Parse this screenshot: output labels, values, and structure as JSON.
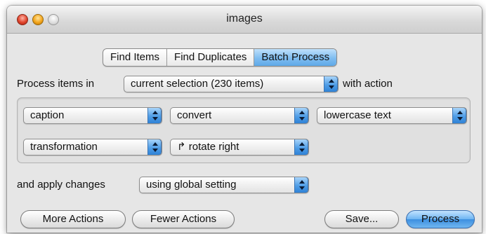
{
  "window": {
    "title": "images"
  },
  "tabs": [
    {
      "label": "Find Items",
      "active": false
    },
    {
      "label": "Find Duplicates",
      "active": false
    },
    {
      "label": "Batch Process",
      "active": true
    }
  ],
  "process_row": {
    "prefix": "Process items in",
    "scope_value": "current selection (230 items)",
    "suffix": "with action"
  },
  "actions": {
    "row1": {
      "target": "caption",
      "operation": "convert",
      "option": "lowercase text"
    },
    "row2": {
      "target": "transformation",
      "operation": "↱ rotate right"
    }
  },
  "apply_row": {
    "label": "and apply changes",
    "value": "using global setting"
  },
  "buttons": {
    "more": "More Actions",
    "fewer": "Fewer Actions",
    "save": "Save...",
    "process": "Process"
  },
  "colors": {
    "accent": "#4f9de6",
    "window_bg": "#e6e6e6",
    "close_light": "#e0442c",
    "minimize_light": "#f3a51b",
    "zoom_light": "#dcdcdc"
  }
}
